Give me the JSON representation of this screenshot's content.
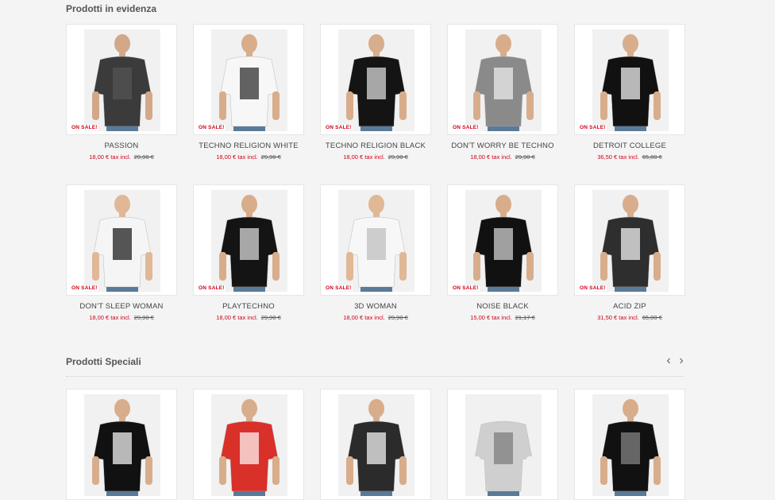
{
  "featured": {
    "title": "Prodotti in evidenza",
    "products": [
      {
        "name": "PASSION",
        "sale_label": "ON SALE!",
        "price": "18,00 € tax incl.",
        "old_price": "29,90 €",
        "shirt": "#3b3b3b",
        "print": "#555555",
        "skin": "#d2a888"
      },
      {
        "name": "TECHNO RELIGION WHITE",
        "sale_label": "ON SALE!",
        "price": "18,00 € tax incl.",
        "old_price": "29,90 €",
        "shirt": "#f7f7f7",
        "print": "#222222",
        "skin": "#d8ad8c"
      },
      {
        "name": "TECHNO RELIGION BLACK",
        "sale_label": "ON SALE!",
        "price": "18,00 € tax incl.",
        "old_price": "29,90 €",
        "shirt": "#141414",
        "print": "#e6e6e6",
        "skin": "#d8ad8c"
      },
      {
        "name": "DON'T WORRY BE TECHNO",
        "sale_label": "ON SALE!",
        "price": "18,00 € tax incl.",
        "old_price": "29,90 €",
        "shirt": "#8a8a8a",
        "print": "#f2f2f2",
        "skin": "#d8ad8c"
      },
      {
        "name": "DETROIT COLLEGE",
        "sale_label": "ON SALE!",
        "price": "36,50 € tax incl.",
        "old_price": "65,00 €",
        "shirt": "#111111",
        "print": "#ffffff",
        "skin": "#d8ad8c"
      },
      {
        "name": "DON'T SLEEP WOMAN",
        "sale_label": "ON SALE!",
        "price": "18,00 € tax incl.",
        "old_price": "29,90 €",
        "shirt": "#f5f5f5",
        "print": "#111111",
        "skin": "#e0b896"
      },
      {
        "name": "PLAYTECHNO",
        "sale_label": "ON SALE!",
        "price": "18,00 € tax incl.",
        "old_price": "29,90 €",
        "shirt": "#141414",
        "print": "#e6e6e6",
        "skin": "#d8ad8c"
      },
      {
        "name": "3D WOMAN",
        "sale_label": "ON SALE!",
        "price": "18,00 € tax incl.",
        "old_price": "29,90 €",
        "shirt": "#f7f7f7",
        "print": "#bbbbbb",
        "skin": "#e0b896"
      },
      {
        "name": "NOISE BLACK",
        "sale_label": "ON SALE!",
        "price": "15,00 € tax incl.",
        "old_price": "21,17 €",
        "shirt": "#111111",
        "print": "#dddddd",
        "skin": "#d8ad8c"
      },
      {
        "name": "ACID ZIP",
        "sale_label": "ON SALE!",
        "price": "31,50 € tax incl.",
        "old_price": "65,00 €",
        "shirt": "#2e2e2e",
        "print": "#ffffff",
        "skin": "#d8ad8c"
      }
    ]
  },
  "specials": {
    "title": "Prodotti Speciali",
    "prev_icon": "chevron-left-icon",
    "next_icon": "chevron-right-icon",
    "products": [
      {
        "shirt": "#111111",
        "print": "#ffffff",
        "skin": "#d8ad8c"
      },
      {
        "shirt": "#d9302a",
        "print": "#ffffff",
        "skin": "#d8ad8c"
      },
      {
        "shirt": "#2b2b2b",
        "print": "#ffffff",
        "skin": "#d8ad8c"
      },
      {
        "shirt": "#cfcfcf",
        "print": "#777777",
        "skin": "#f1f1f1"
      },
      {
        "shirt": "#111111",
        "print": "#8a8a8a",
        "skin": "#d8ad8c"
      }
    ]
  }
}
